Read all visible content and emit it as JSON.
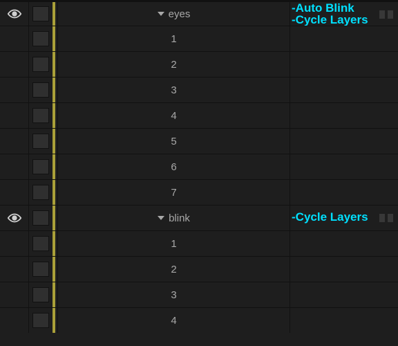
{
  "colors": {
    "label_strip": "#aaa039",
    "tag_text": "#00e0ff"
  },
  "rows": [
    {
      "kind": "group",
      "visible": true,
      "label": "eyes",
      "tags": "-Auto Blink\n-Cycle Layers"
    },
    {
      "kind": "child",
      "visible": false,
      "label": "1",
      "tags": ""
    },
    {
      "kind": "child",
      "visible": false,
      "label": "2",
      "tags": ""
    },
    {
      "kind": "child",
      "visible": false,
      "label": "3",
      "tags": ""
    },
    {
      "kind": "child",
      "visible": false,
      "label": "4",
      "tags": ""
    },
    {
      "kind": "child",
      "visible": false,
      "label": "5",
      "tags": ""
    },
    {
      "kind": "child",
      "visible": false,
      "label": "6",
      "tags": ""
    },
    {
      "kind": "child",
      "visible": false,
      "label": "7",
      "tags": ""
    },
    {
      "kind": "group",
      "visible": true,
      "label": "blink",
      "tags": "-Cycle Layers"
    },
    {
      "kind": "child",
      "visible": false,
      "label": "1",
      "tags": ""
    },
    {
      "kind": "child",
      "visible": false,
      "label": "2",
      "tags": ""
    },
    {
      "kind": "child",
      "visible": false,
      "label": "3",
      "tags": ""
    },
    {
      "kind": "child",
      "visible": false,
      "label": "4",
      "tags": ""
    }
  ]
}
